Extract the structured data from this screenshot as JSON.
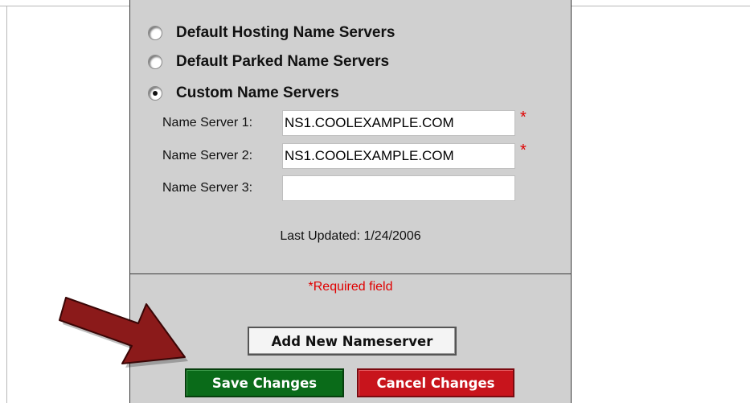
{
  "radio_options": [
    {
      "label": "Default Hosting Name Servers",
      "selected": false
    },
    {
      "label": "Default Parked Name Servers",
      "selected": false
    },
    {
      "label": "Custom Name Servers",
      "selected": true
    }
  ],
  "name_servers": [
    {
      "label": "Name Server 1:",
      "value": "NS1.COOLEXAMPLE.COM",
      "required": true
    },
    {
      "label": "Name Server 2:",
      "value": "NS1.COOLEXAMPLE.COM",
      "required": true
    },
    {
      "label": "Name Server 3:",
      "value": "",
      "required": false
    }
  ],
  "required_marker": "*",
  "last_updated": "Last Updated: 1/24/2006",
  "required_note": "*Required field",
  "buttons": {
    "add": "Add New Nameserver",
    "save": "Save Changes",
    "cancel": "Cancel Changes"
  },
  "colors": {
    "panel": "#d0d0d0",
    "required": "#e00000",
    "save": "#0a6b19",
    "cancel": "#c8141c",
    "arrow": "#8b1a1a"
  },
  "icons": {
    "pointer": "arrow-icon"
  }
}
